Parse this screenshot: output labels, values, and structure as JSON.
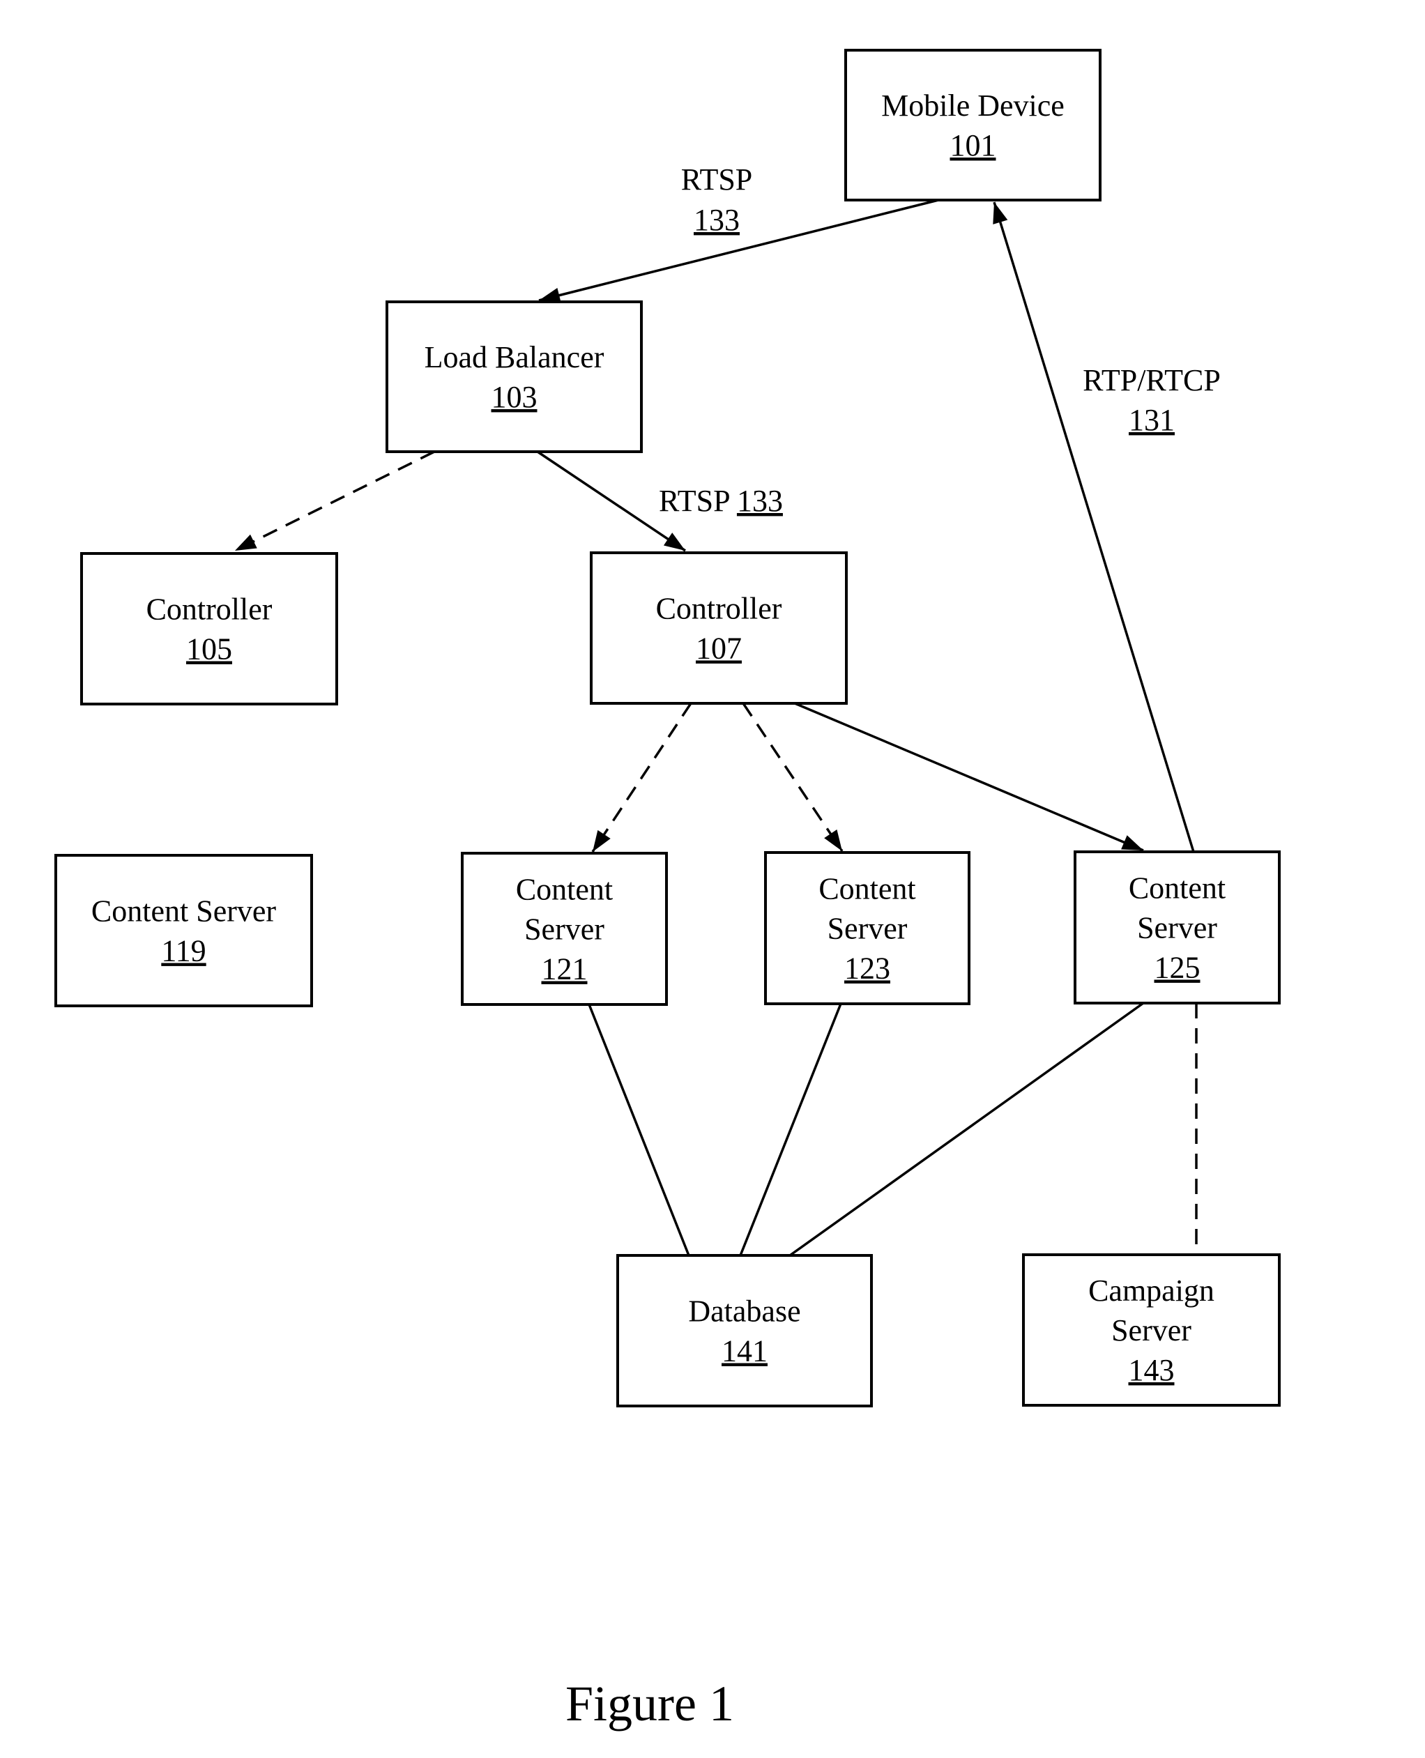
{
  "figure": {
    "caption": "Figure 1"
  },
  "nodes": [
    {
      "id": "mobile-device",
      "lines": [
        "Mobile Device"
      ],
      "ref": "101"
    },
    {
      "id": "load-balancer",
      "lines": [
        "Load Balancer"
      ],
      "ref": "103"
    },
    {
      "id": "controller-105",
      "lines": [
        "Controller"
      ],
      "ref": "105"
    },
    {
      "id": "controller-107",
      "lines": [
        "Controller"
      ],
      "ref": "107"
    },
    {
      "id": "content-server-119",
      "lines": [
        "Content Server"
      ],
      "ref": "119"
    },
    {
      "id": "content-server-121",
      "lines": [
        "Content",
        "Server"
      ],
      "ref": "121"
    },
    {
      "id": "content-server-123",
      "lines": [
        "Content",
        "Server"
      ],
      "ref": "123"
    },
    {
      "id": "content-server-125",
      "lines": [
        "Content",
        "Server"
      ],
      "ref": "125"
    },
    {
      "id": "database-141",
      "lines": [
        "Database"
      ],
      "ref": "141"
    },
    {
      "id": "campaign-server-143",
      "lines": [
        "Campaign",
        "Server"
      ],
      "ref": "143"
    }
  ],
  "edges": [
    {
      "from": "mobile-device",
      "to": "load-balancer",
      "style": "solid",
      "arrow": true,
      "label": "RTSP",
      "label_ref": "133"
    },
    {
      "from": "load-balancer",
      "to": "controller-105",
      "style": "dashed",
      "arrow": true
    },
    {
      "from": "load-balancer",
      "to": "controller-107",
      "style": "solid",
      "arrow": true,
      "label": "RTSP",
      "label_ref": "133"
    },
    {
      "from": "controller-107",
      "to": "content-server-121",
      "style": "dashed",
      "arrow": true
    },
    {
      "from": "controller-107",
      "to": "content-server-123",
      "style": "dashed",
      "arrow": true
    },
    {
      "from": "controller-107",
      "to": "content-server-125",
      "style": "solid",
      "arrow": true
    },
    {
      "from": "content-server-125",
      "to": "mobile-device",
      "style": "solid",
      "arrow": true,
      "label": "RTP/RTCP",
      "label_ref": "131"
    },
    {
      "from": "content-server-121",
      "to": "database-141",
      "style": "solid",
      "arrow": false
    },
    {
      "from": "content-server-123",
      "to": "database-141",
      "style": "solid",
      "arrow": false
    },
    {
      "from": "content-server-125",
      "to": "database-141",
      "style": "solid",
      "arrow": false
    },
    {
      "from": "content-server-125",
      "to": "campaign-server-143",
      "style": "dashed",
      "arrow": false
    }
  ]
}
